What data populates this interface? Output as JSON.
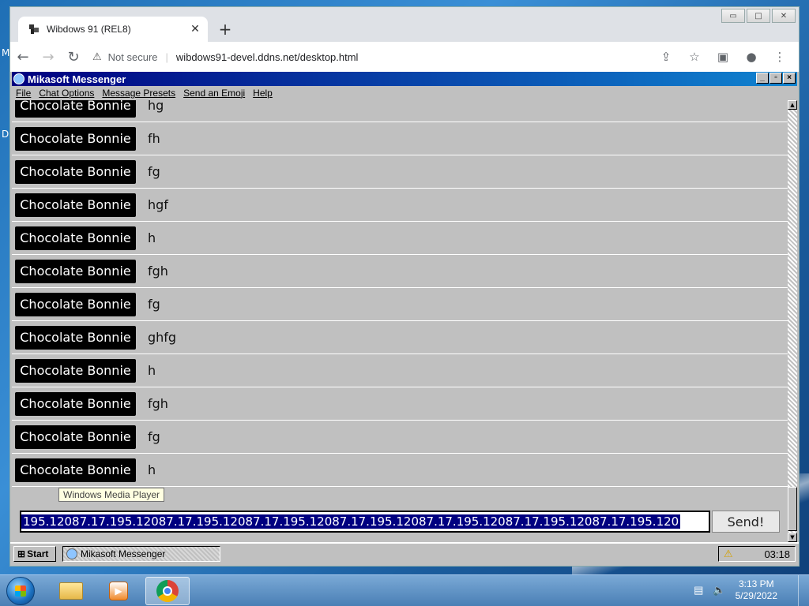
{
  "desktop": {
    "edge_letters": [
      "M",
      "D"
    ]
  },
  "browser": {
    "tab_title": "Wibdows 91 (REL8)",
    "security_label": "Not secure",
    "url": "wibdows91-devel.ddns.net/desktop.html"
  },
  "messenger": {
    "title": "Mikasoft Messenger",
    "menu": [
      "File",
      "Chat Options",
      "Message Presets",
      "Send an Emoji",
      "Help"
    ],
    "messages": [
      {
        "name": "Chocolate Bonnie",
        "text": "hg"
      },
      {
        "name": "Chocolate Bonnie",
        "text": "fh"
      },
      {
        "name": "Chocolate Bonnie",
        "text": "fg"
      },
      {
        "name": "Chocolate Bonnie",
        "text": "hgf"
      },
      {
        "name": "Chocolate Bonnie",
        "text": "h"
      },
      {
        "name": "Chocolate Bonnie",
        "text": "fgh"
      },
      {
        "name": "Chocolate Bonnie",
        "text": "fg"
      },
      {
        "name": "Chocolate Bonnie",
        "text": "ghfg"
      },
      {
        "name": "Chocolate Bonnie",
        "text": "h"
      },
      {
        "name": "Chocolate Bonnie",
        "text": "fgh"
      },
      {
        "name": "Chocolate Bonnie",
        "text": "fg"
      },
      {
        "name": "Chocolate Bonnie",
        "text": "h"
      }
    ],
    "input_value": "195.12087.17.195.12087.17.195.12087.17.195.12087.17.195.12087.17.195.12087.17.195.12087.17.195.120",
    "send_label": "Send!"
  },
  "win98_taskbar": {
    "start_label": "Start",
    "task_label": "Mikasoft Messenger",
    "tooltip": "Windows Media Player",
    "clock": "03:18"
  },
  "win7_taskbar": {
    "time": "3:13 PM",
    "date": "5/29/2022"
  },
  "colors": {
    "title_bar": "#000080",
    "chat_bg": "#c0c0c0",
    "name_badge": "#000000",
    "selection": "#000080"
  }
}
